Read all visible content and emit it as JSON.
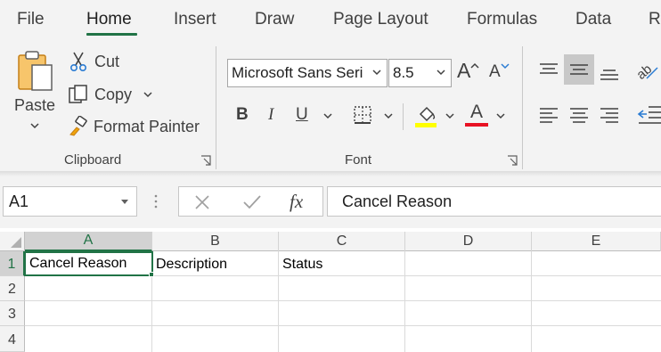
{
  "menu": {
    "tabs": [
      {
        "label": "File"
      },
      {
        "label": "Home"
      },
      {
        "label": "Insert"
      },
      {
        "label": "Draw"
      },
      {
        "label": "Page Layout"
      },
      {
        "label": "Formulas"
      },
      {
        "label": "Data"
      },
      {
        "label": "Re"
      }
    ],
    "active_tab": "Home",
    "accent_color": "#217346"
  },
  "ribbon": {
    "clipboard": {
      "paste_label": "Paste",
      "cut_label": "Cut",
      "copy_label": "Copy",
      "format_painter_label": "Format Painter",
      "group_label": "Clipboard"
    },
    "font": {
      "font_name": "Microsoft Sans Seri",
      "font_size": "8.5",
      "grow_label": "A",
      "shrink_label": "A",
      "bold_label": "B",
      "italic_label": "I",
      "underline_label": "U",
      "font_color_letter": "A",
      "highlight_color": "#ffff00",
      "font_color": "#e81123",
      "group_label": "Font"
    }
  },
  "formula_bar": {
    "name_box": "A1",
    "fx_label": "fx",
    "value": "Cancel Reason"
  },
  "sheet": {
    "columns": [
      "A",
      "B",
      "C",
      "D",
      "E"
    ],
    "rows": [
      "1",
      "2",
      "3",
      "4"
    ],
    "selected_cell": "A1",
    "cells": {
      "A1": "Cancel Reason",
      "B1": "Description",
      "C1": "Status"
    }
  }
}
